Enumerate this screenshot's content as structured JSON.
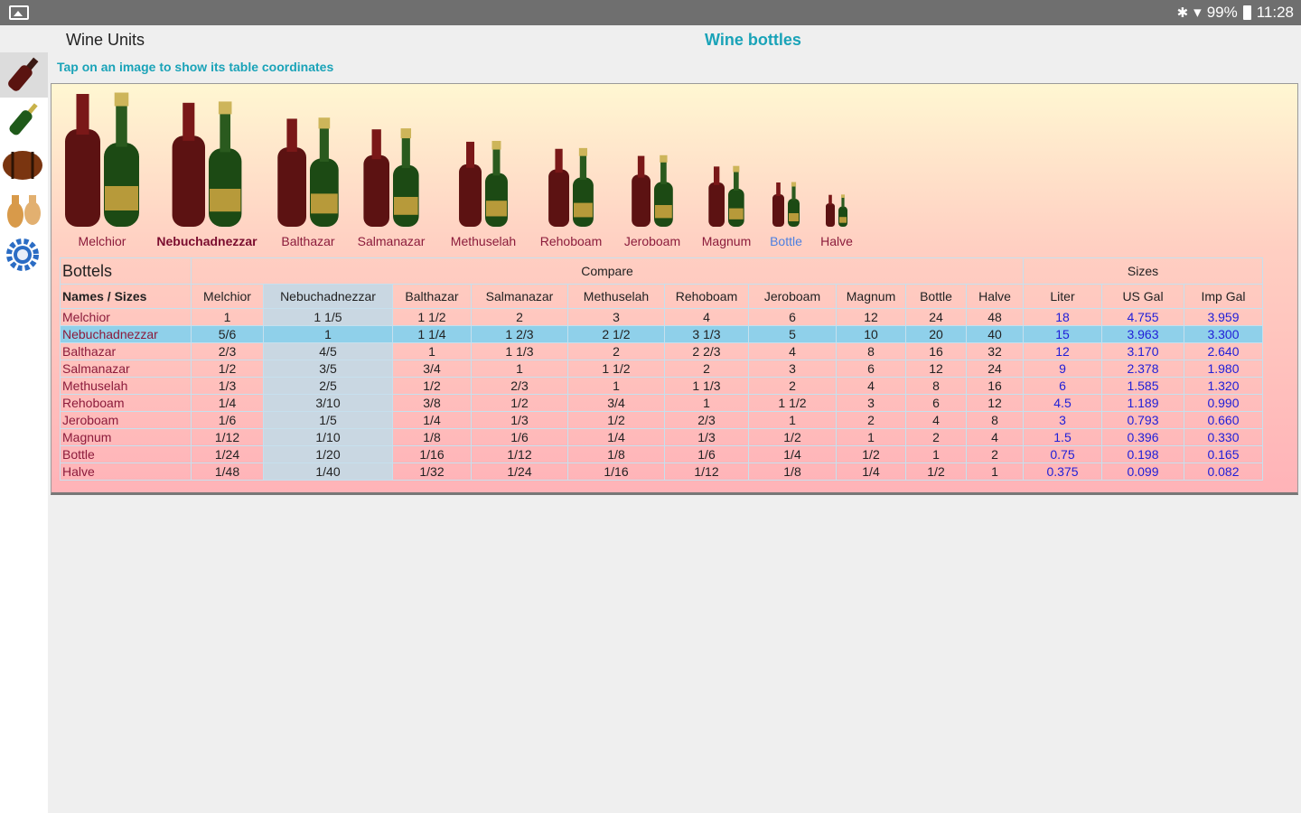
{
  "status": {
    "battery": "99%",
    "time": "11:28"
  },
  "header": {
    "app_title": "Wine Units",
    "screen_title": "Wine bottles",
    "hint": "Tap on an image to show its table coordinates"
  },
  "sidebar": {
    "items": [
      {
        "name": "wine-bottle-icon",
        "active": true
      },
      {
        "name": "champagne-bottle-icon",
        "active": false
      },
      {
        "name": "barrel-icon",
        "active": false
      },
      {
        "name": "amphora-icon",
        "active": false
      },
      {
        "name": "settings-gear-icon",
        "active": false
      }
    ]
  },
  "bottles": [
    {
      "name": "Melchior"
    },
    {
      "name": "Nebuchadnezzar"
    },
    {
      "name": "Balthazar"
    },
    {
      "name": "Salmanazar"
    },
    {
      "name": "Methuselah"
    },
    {
      "name": "Rehoboam"
    },
    {
      "name": "Jeroboam"
    },
    {
      "name": "Magnum"
    },
    {
      "name": "Bottle"
    },
    {
      "name": "Halve"
    }
  ],
  "table": {
    "corner_label": "Bottels",
    "compare_label": "Compare",
    "sizes_label": "Sizes",
    "names_sizes_label": "Names / Sizes",
    "compare_headers": [
      "Melchior",
      "Nebuchadnezzar",
      "Balthazar",
      "Salmanazar",
      "Methuselah",
      "Rehoboam",
      "Jeroboam",
      "Magnum",
      "Bottle",
      "Halve"
    ],
    "size_headers": [
      "Liter",
      "US Gal",
      "Imp Gal"
    ],
    "rows": [
      {
        "name": "Melchior",
        "compare": [
          "1",
          "1 1/5",
          "1 1/2",
          "2",
          "3",
          "4",
          "6",
          "12",
          "24",
          "48"
        ],
        "sizes": [
          "18",
          "4.755",
          "3.959"
        ]
      },
      {
        "name": "Nebuchadnezzar",
        "compare": [
          "5/6",
          "1",
          "1 1/4",
          "1 2/3",
          "2 1/2",
          "3 1/3",
          "5",
          "10",
          "20",
          "40"
        ],
        "sizes": [
          "15",
          "3.963",
          "3.300"
        ]
      },
      {
        "name": "Balthazar",
        "compare": [
          "2/3",
          "4/5",
          "1",
          "1 1/3",
          "2",
          "2 2/3",
          "4",
          "8",
          "16",
          "32"
        ],
        "sizes": [
          "12",
          "3.170",
          "2.640"
        ]
      },
      {
        "name": "Salmanazar",
        "compare": [
          "1/2",
          "3/5",
          "3/4",
          "1",
          "1 1/2",
          "2",
          "3",
          "6",
          "12",
          "24"
        ],
        "sizes": [
          "9",
          "2.378",
          "1.980"
        ]
      },
      {
        "name": "Methuselah",
        "compare": [
          "1/3",
          "2/5",
          "1/2",
          "2/3",
          "1",
          "1 1/3",
          "2",
          "4",
          "8",
          "16"
        ],
        "sizes": [
          "6",
          "1.585",
          "1.320"
        ]
      },
      {
        "name": "Rehoboam",
        "compare": [
          "1/4",
          "3/10",
          "3/8",
          "1/2",
          "3/4",
          "1",
          "1 1/2",
          "3",
          "6",
          "12"
        ],
        "sizes": [
          "4.5",
          "1.189",
          "0.990"
        ]
      },
      {
        "name": "Jeroboam",
        "compare": [
          "1/6",
          "1/5",
          "1/4",
          "1/3",
          "1/2",
          "2/3",
          "1",
          "2",
          "4",
          "8"
        ],
        "sizes": [
          "3",
          "0.793",
          "0.660"
        ]
      },
      {
        "name": "Magnum",
        "compare": [
          "1/12",
          "1/10",
          "1/8",
          "1/6",
          "1/4",
          "1/3",
          "1/2",
          "1",
          "2",
          "4"
        ],
        "sizes": [
          "1.5",
          "0.396",
          "0.330"
        ]
      },
      {
        "name": "Bottle",
        "compare": [
          "1/24",
          "1/20",
          "1/16",
          "1/12",
          "1/8",
          "1/6",
          "1/4",
          "1/2",
          "1",
          "2"
        ],
        "sizes": [
          "0.75",
          "0.198",
          "0.165"
        ]
      },
      {
        "name": "Halve",
        "compare": [
          "1/48",
          "1/40",
          "1/32",
          "1/24",
          "1/16",
          "1/12",
          "1/8",
          "1/4",
          "1/2",
          "1"
        ],
        "sizes": [
          "0.375",
          "0.099",
          "0.082"
        ]
      }
    ]
  }
}
